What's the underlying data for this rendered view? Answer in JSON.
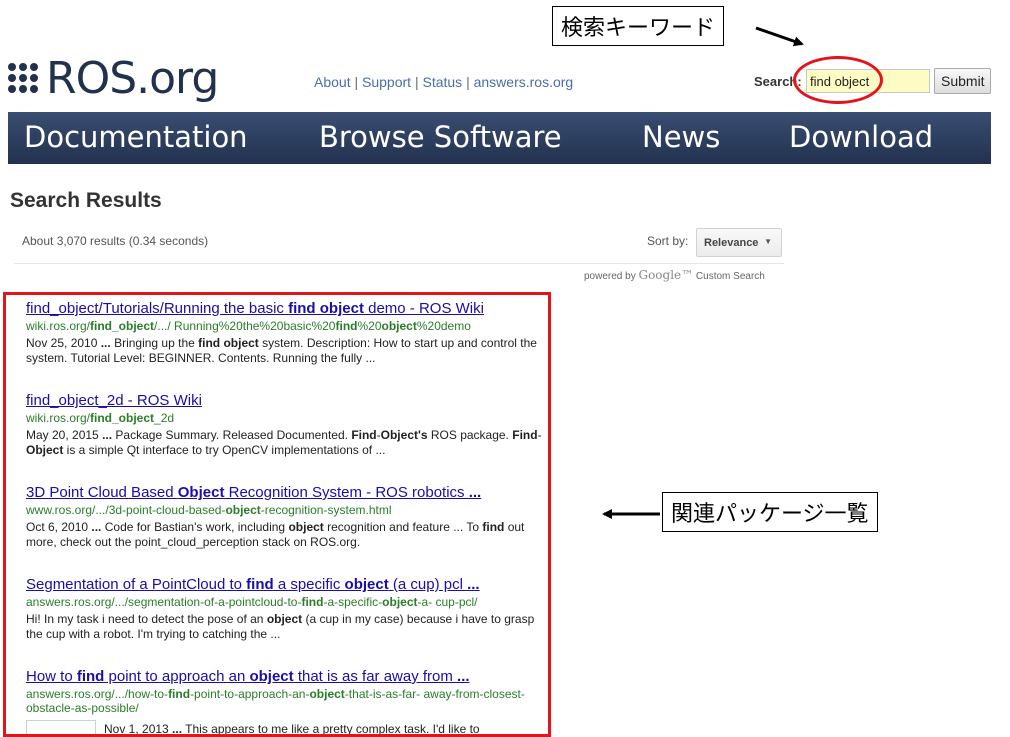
{
  "header": {
    "logo_text": "ROS.org",
    "links": [
      "About",
      "Support",
      "Status",
      "answers.ros.org"
    ],
    "separator": " | ",
    "search_label": "Search:",
    "search_value": "find object",
    "submit_label": "Submit"
  },
  "nav": {
    "items": [
      "Documentation",
      "Browse Software",
      "News",
      "Download"
    ]
  },
  "results_header": {
    "title": "Search Results",
    "count": "About 3,070 results (0.34 seconds)",
    "sort_label": "Sort by:",
    "sort_value": "Relevance",
    "powered_prefix": "powered by",
    "powered_google": "Google™",
    "powered_suffix": "Custom Search"
  },
  "results": [
    {
      "title": [
        [
          "find_object/Tutorials/Running the basic ",
          false
        ],
        [
          "find object",
          true
        ],
        [
          " demo - ROS Wiki",
          false
        ]
      ],
      "url": [
        [
          "wiki.ros.org/",
          false
        ],
        [
          "find_object",
          true
        ],
        [
          "/.../ Running%20the%20basic%20",
          false
        ],
        [
          "find",
          true
        ],
        [
          "%20",
          false
        ],
        [
          "object",
          true
        ],
        [
          "%20demo",
          false
        ]
      ],
      "snippet": [
        [
          "Nov 25, 2010 ",
          false
        ],
        [
          "...",
          true
        ],
        [
          " Bringing up the ",
          false
        ],
        [
          "find object",
          true
        ],
        [
          " system. Description: How to start up and control the system. Tutorial Level: BEGINNER. Contents. Running the fully ...",
          false
        ]
      ]
    },
    {
      "title": [
        [
          "find_object_2d - ROS Wiki",
          false
        ]
      ],
      "url": [
        [
          "wiki.ros.org/",
          false
        ],
        [
          "find_object",
          true
        ],
        [
          "_2d",
          false
        ]
      ],
      "snippet": [
        [
          "May 20, 2015 ",
          false
        ],
        [
          "...",
          true
        ],
        [
          " Package Summary. Released Documented. ",
          false
        ],
        [
          "Find",
          true
        ],
        [
          "-",
          false
        ],
        [
          "Object's",
          true
        ],
        [
          " ROS package. ",
          false
        ],
        [
          "Find",
          true
        ],
        [
          "- ",
          false
        ],
        [
          "Object",
          true
        ],
        [
          " is a simple Qt interface to try OpenCV implementations of ...",
          false
        ]
      ]
    },
    {
      "title": [
        [
          "3D Point Cloud Based ",
          false
        ],
        [
          "Object",
          true
        ],
        [
          " Recognition System - ROS robotics ",
          false
        ],
        [
          "...",
          true
        ]
      ],
      "url": [
        [
          "www.ros.org/.../3d-point-cloud-based-",
          false
        ],
        [
          "object",
          true
        ],
        [
          "-recognition-system.html",
          false
        ]
      ],
      "snippet": [
        [
          "Oct 6, 2010 ",
          false
        ],
        [
          "...",
          true
        ],
        [
          " Code for Bastian's work, including ",
          false
        ],
        [
          "object",
          true
        ],
        [
          " recognition and feature ... To ",
          false
        ],
        [
          "find",
          true
        ],
        [
          " out more, check out the point_cloud_perception stack on ROS.org.",
          false
        ]
      ]
    },
    {
      "title": [
        [
          "Segmentation of a PointCloud to ",
          false
        ],
        [
          "find",
          true
        ],
        [
          " a specific ",
          false
        ],
        [
          "object",
          true
        ],
        [
          " (a cup) pcl ",
          false
        ],
        [
          "...",
          true
        ]
      ],
      "url": [
        [
          "answers.ros.org/.../segmentation-of-a-pointcloud-to-",
          false
        ],
        [
          "find",
          true
        ],
        [
          "-a-specific-",
          false
        ],
        [
          "object",
          true
        ],
        [
          "-a- cup-pcl/",
          false
        ]
      ],
      "snippet": [
        [
          "Hi! In my task i need to detect the pose of an ",
          false
        ],
        [
          "object",
          true
        ],
        [
          " (a cup in my case) because i have to grasp the cup with a robot. I'm trying to catching the ...",
          false
        ]
      ]
    },
    {
      "title": [
        [
          "How to ",
          false
        ],
        [
          "find",
          true
        ],
        [
          " point to approach an ",
          false
        ],
        [
          "object",
          true
        ],
        [
          " that is as far away from ",
          false
        ],
        [
          "...",
          true
        ]
      ],
      "url": [
        [
          "answers.ros.org/.../how-to-",
          false
        ],
        [
          "find",
          true
        ],
        [
          "-point-to-approach-an-",
          false
        ],
        [
          "object",
          true
        ],
        [
          "-that-is-as-far- away-from-closest-obstacle-as-possible/",
          false
        ]
      ],
      "snippet": [
        [
          "Nov 1, 2013 ",
          false
        ],
        [
          "...",
          true
        ],
        [
          " This appears to me like a pretty complex task. I'd like to",
          false
        ]
      ]
    }
  ],
  "annotations": {
    "keyword_callout": "検索キーワード",
    "packages_callout": "関連パッケージ一覧"
  },
  "colors": {
    "brand_navy": "#22314e",
    "nav_gradient_top": "#3a4e72",
    "link_blue": "#1a0dab",
    "url_green": "#2a7d2a",
    "annotation_red": "#e3141a",
    "search_input_bg": "#fdfcc4"
  }
}
